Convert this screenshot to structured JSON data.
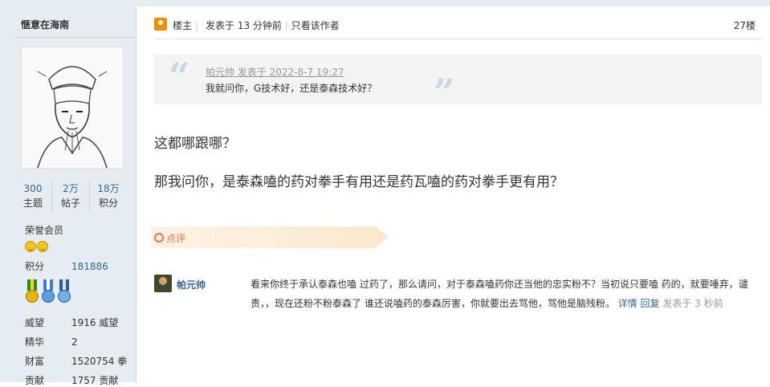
{
  "author": {
    "name": "惬意在海南",
    "stats": [
      {
        "value": "300",
        "label": "主题"
      },
      {
        "value": "2万",
        "label": "帖子"
      },
      {
        "value": "18万",
        "label": "积分"
      }
    ],
    "rank": "荣誉会员",
    "score_label": "积分",
    "score_value": "181886",
    "fields": [
      {
        "key": "威望",
        "value": "1916 威望"
      },
      {
        "key": "精华",
        "value": "2"
      },
      {
        "key": "财富",
        "value": "1520754 拳"
      },
      {
        "key": "贡献",
        "value": "1757 贡献"
      }
    ]
  },
  "post": {
    "host_label": "楼主",
    "posted": "发表于 13 分钟前",
    "only_author": "只看该作者",
    "floor": "27楼",
    "quote": {
      "meta": "帕元帅 发表于 2022-8-7 19:27",
      "text": "我就问你，G技术好，还是泰森技术好？"
    },
    "lines": [
      "这都哪跟哪？",
      "那我问你，是泰森嗑的药对拳手有用还是药瓦嗑的药对拳手更有用？"
    ]
  },
  "comments": {
    "tab_label": "点评",
    "items": [
      {
        "author": "帕元帅",
        "text_line1": "看来你终于承认泰森也嗑 过药了，那么请问，对于泰森嗑药你还当他的忠实粉不？当初说只要嗑 药的，就要唾弃，谴",
        "text_line2": "责，，现在还粉不粉泰森了 谁还说嗑药的泰森厉害，你就要出去骂他，骂他是脑残粉。",
        "detail": "详情",
        "reply": "回复",
        "time": "发表于 3 秒前"
      }
    ]
  }
}
